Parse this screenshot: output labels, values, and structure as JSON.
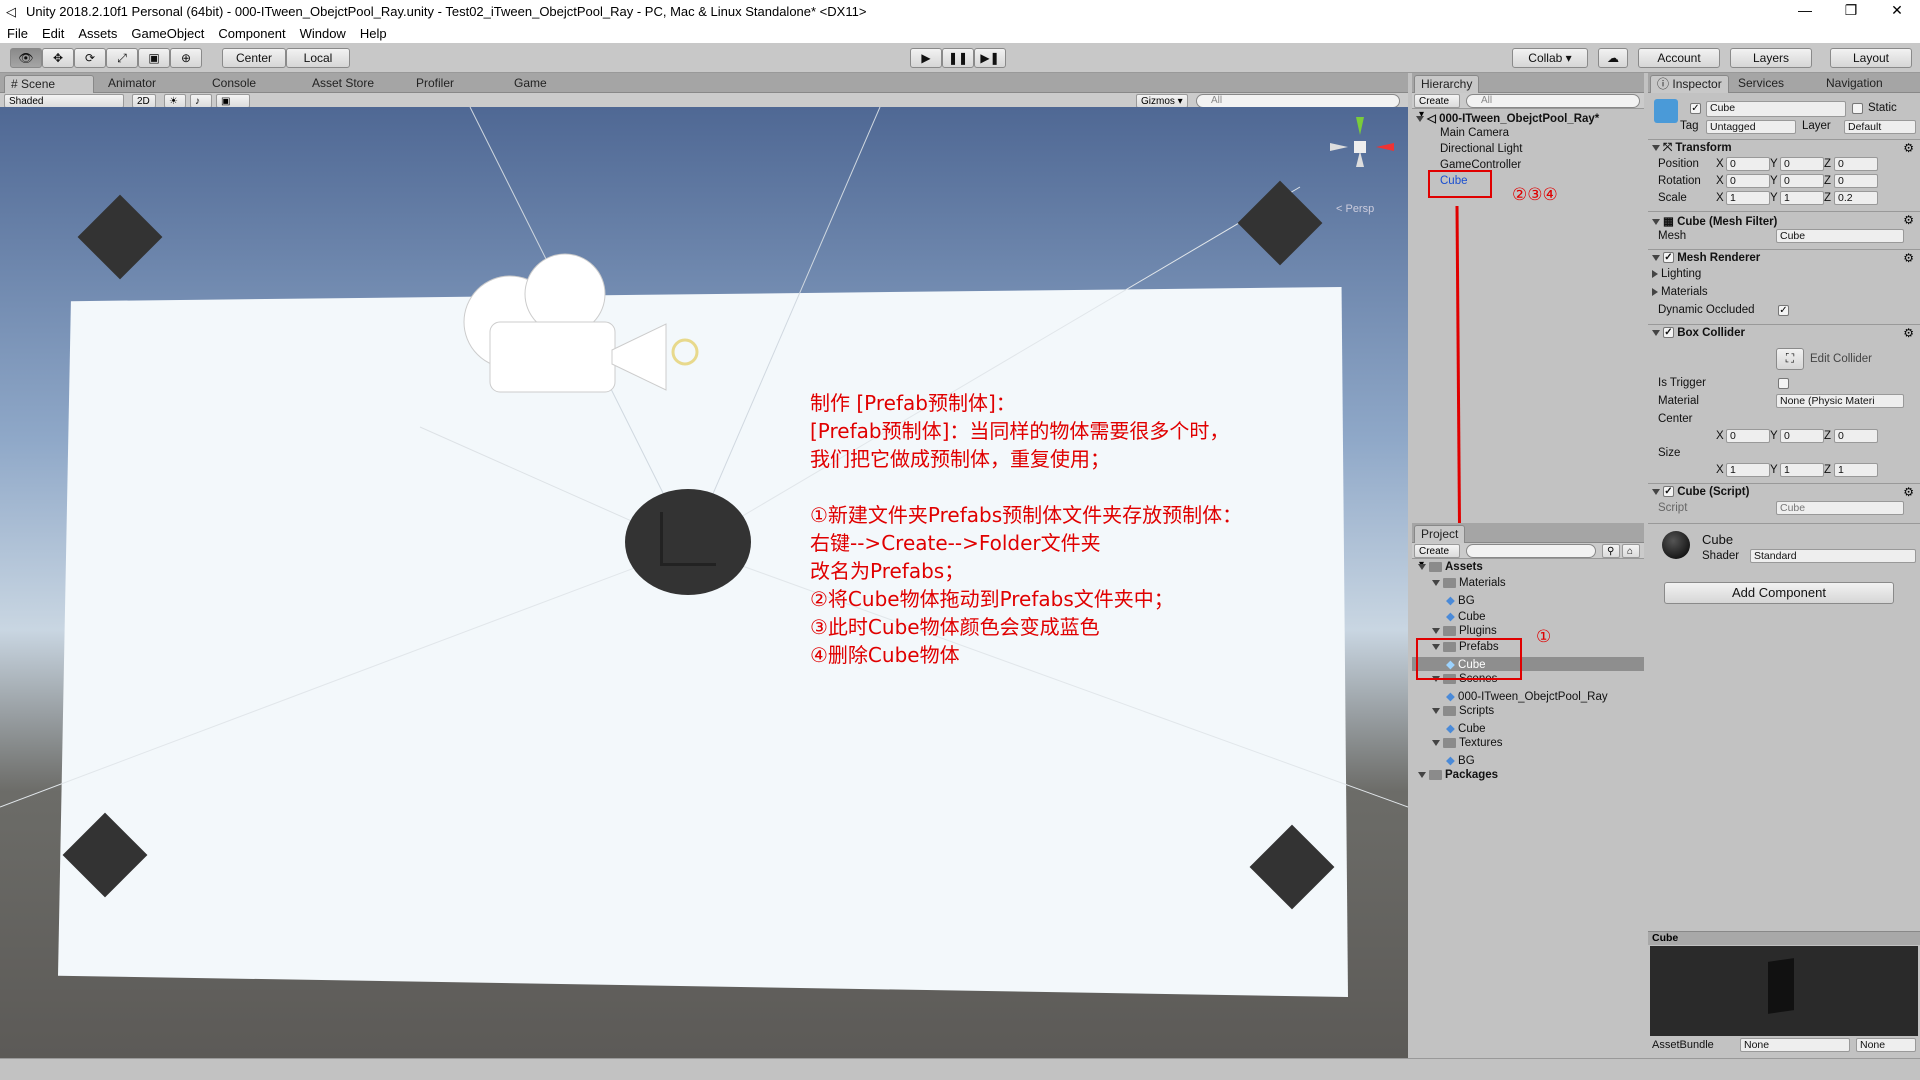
{
  "window": {
    "title": "Unity 2018.2.10f1 Personal (64bit) - 000-ITween_ObejctPool_Ray.unity - Test02_iTween_ObejctPool_Ray - PC, Mac & Linux Standalone* <DX11>"
  },
  "menu": [
    "File",
    "Edit",
    "Assets",
    "GameObject",
    "Component",
    "Window",
    "Help"
  ],
  "toolbar": {
    "center": "Center",
    "local": "Local",
    "collab": "Collab ▾",
    "account": "Account",
    "layers": "Layers",
    "layout": "Layout"
  },
  "scene_tabs": [
    "Scene",
    "Animator",
    "Console",
    "Asset Store",
    "Profiler",
    "Game"
  ],
  "scene_bar": {
    "shaded": "Shaded",
    "mode2d": "2D",
    "gizmos": "Gizmos ▾",
    "search": "All",
    "persp": "< Persp"
  },
  "annotation": {
    "lines": [
      "制作 [Prefab预制体]：",
      "[Prefab预制体]：当同样的物体需要很多个时，",
      "我们把它做成预制体，重复使用；",
      "",
      "①新建文件夹Prefabs预制体文件夹存放预制体：",
      "右键-->Create-->Folder文件夹",
      "改名为Prefabs；",
      "②将Cube物体拖动到Prefabs文件夹中；",
      "③此时Cube物体颜色会变成蓝色",
      "④删除Cube物体"
    ],
    "marker_hier": "②③④",
    "marker_proj": "①"
  },
  "hierarchy": {
    "tab": "Hierarchy",
    "create": "Create ▾",
    "search": "All",
    "scene": "000-ITween_ObejctPool_Ray*",
    "items": [
      "Main Camera",
      "Directional Light",
      "GameController",
      "Cube"
    ]
  },
  "project": {
    "tab": "Project",
    "create": "Create ▾",
    "tree": [
      {
        "label": "Assets",
        "depth": 0,
        "folder": true,
        "bold": true
      },
      {
        "label": "Materials",
        "depth": 1,
        "folder": true
      },
      {
        "label": "BG",
        "depth": 2
      },
      {
        "label": "Cube",
        "depth": 2
      },
      {
        "label": "Plugins",
        "depth": 1,
        "folder": true
      },
      {
        "label": "Prefabs",
        "depth": 1,
        "folder": true
      },
      {
        "label": "Cube",
        "depth": 2,
        "selected": true
      },
      {
        "label": "Scenes",
        "depth": 1,
        "folder": true
      },
      {
        "label": "000-ITween_ObejctPool_Ray",
        "depth": 2
      },
      {
        "label": "Scripts",
        "depth": 1,
        "folder": true
      },
      {
        "label": "Cube",
        "depth": 2
      },
      {
        "label": "Textures",
        "depth": 1,
        "folder": true
      },
      {
        "label": "BG",
        "depth": 2
      },
      {
        "label": "Packages",
        "depth": 0,
        "folder": true,
        "bold": true
      }
    ]
  },
  "inspector": {
    "tabs": [
      "Inspector",
      "Services",
      "Navigation"
    ],
    "name": "Cube",
    "static": "Static",
    "tag_label": "Tag",
    "tag": "Untagged",
    "layer_label": "Layer",
    "layer": "Default",
    "transform": {
      "title": "Transform",
      "position": [
        "0",
        "0",
        "0"
      ],
      "rotation": [
        "0",
        "0",
        "0"
      ],
      "scale": [
        "1",
        "1",
        "0.2"
      ],
      "labels": [
        "Position",
        "Rotation",
        "Scale"
      ]
    },
    "mesh_filter": {
      "title": "Cube (Mesh Filter)",
      "mesh_label": "Mesh",
      "mesh": "Cube"
    },
    "mesh_renderer": {
      "title": "Mesh Renderer",
      "lighting": "Lighting",
      "materials": "Materials",
      "dynamic": "Dynamic Occluded"
    },
    "box_collider": {
      "title": "Box Collider",
      "edit": "Edit Collider",
      "trigger": "Is Trigger",
      "material_label": "Material",
      "material": "None (Physic Materi",
      "center": "Center",
      "center_v": [
        "0",
        "0",
        "0"
      ],
      "size": "Size",
      "size_v": [
        "1",
        "1",
        "1"
      ]
    },
    "script": {
      "title": "Cube (Script)",
      "script_label": "Script",
      "script": "Cube"
    },
    "material": {
      "name": "Cube",
      "shader_label": "Shader",
      "shader": "Standard"
    },
    "add_component": "Add Component",
    "preview_title": "Cube",
    "assetbundle": "AssetBundle",
    "ab_none1": "None",
    "ab_none2": "None"
  }
}
